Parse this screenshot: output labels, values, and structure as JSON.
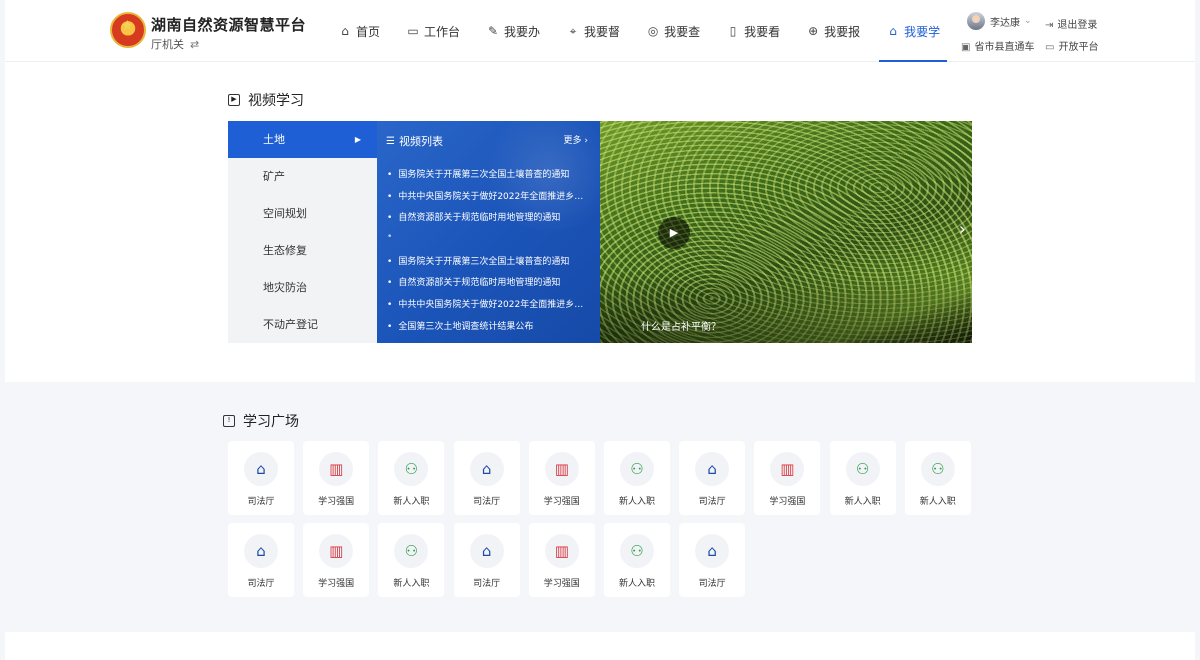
{
  "header": {
    "title": "湖南自然资源智慧平台",
    "org": "厅机关",
    "swap_icon": "⇄",
    "nav": [
      {
        "label": "首页",
        "icon": "⌂",
        "icon_name": "home-icon"
      },
      {
        "label": "工作台",
        "icon": "▭",
        "icon_name": "monitor-icon"
      },
      {
        "label": "我要办",
        "icon": "✎",
        "icon_name": "pen-icon"
      },
      {
        "label": "我要督",
        "icon": "⌖",
        "icon_name": "supervise-icon"
      },
      {
        "label": "我要查",
        "icon": "◎",
        "icon_name": "shield-search-icon"
      },
      {
        "label": "我要看",
        "icon": "▯",
        "icon_name": "book-icon"
      },
      {
        "label": "我要报",
        "icon": "⊕",
        "icon_name": "report-icon"
      },
      {
        "label": "我要学",
        "icon": "⌂",
        "icon_name": "study-icon"
      }
    ],
    "active_nav": "我要学",
    "user_name": "李达康",
    "logout": "退出登录",
    "link_1": "省市县直通车",
    "link_2": "开放平台"
  },
  "video": {
    "section_title": "视频学习",
    "categories": [
      "土地",
      "矿产",
      "空间规划",
      "生态修复",
      "地灾防治",
      "不动产登记"
    ],
    "active_category": "土地",
    "list_title": "视频列表",
    "more": "更多",
    "items": [
      "国务院关于开展第三次全国土壤普查的通知",
      "中共中央国务院关于做好2022年全面推进乡村振兴重点工作的意见",
      "自然资源部关于规范临时用地管理的通知",
      "",
      "国务院关于开展第三次全国土壤普查的通知",
      "自然资源部关于规范临时用地管理的通知",
      "中共中央国务院关于做好2022年全面推进乡村振兴重点工作的意见",
      "全国第三次土地调查统计结果公布"
    ],
    "caption": "什么是占补平衡？"
  },
  "study": {
    "section_title": "学习广场",
    "tiles": [
      {
        "label": "司法厅",
        "type": "court"
      },
      {
        "label": "学习强国",
        "type": "book"
      },
      {
        "label": "新人入职",
        "type": "user"
      },
      {
        "label": "司法厅",
        "type": "court"
      },
      {
        "label": "学习强国",
        "type": "book"
      },
      {
        "label": "新人入职",
        "type": "user"
      },
      {
        "label": "司法厅",
        "type": "court"
      },
      {
        "label": "学习强国",
        "type": "book"
      },
      {
        "label": "新人入职",
        "type": "user"
      },
      {
        "label": "新人入职",
        "type": "user"
      },
      {
        "label": "司法厅",
        "type": "court"
      },
      {
        "label": "学习强国",
        "type": "book"
      },
      {
        "label": "新人入职",
        "type": "user"
      },
      {
        "label": "司法厅",
        "type": "court"
      },
      {
        "label": "学习强国",
        "type": "book"
      },
      {
        "label": "新人入职",
        "type": "user"
      },
      {
        "label": "司法厅",
        "type": "court"
      }
    ]
  },
  "colors": {
    "accent": "#1f5fd6",
    "court": "#1e4aa8",
    "book": "#d9363e",
    "user": "#2b9a48"
  }
}
